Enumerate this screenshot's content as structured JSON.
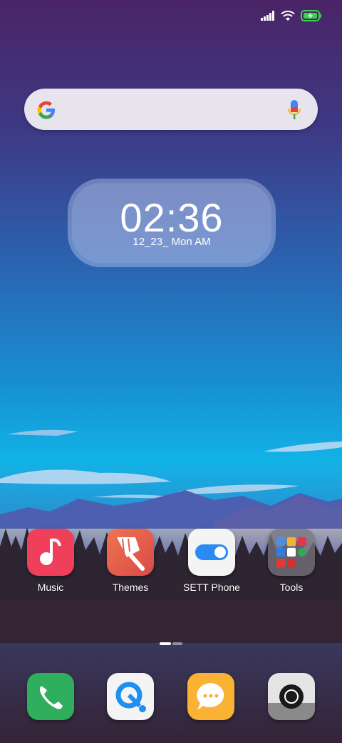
{
  "status_bar": {
    "icons": [
      "signal-icon",
      "wifi-icon",
      "battery-charging-icon"
    ]
  },
  "search_bar": {
    "logo": "google-logo",
    "mic": "mic-icon"
  },
  "clock_widget": {
    "time": "02:36",
    "date": "12_23_ Mon AM"
  },
  "apps": [
    {
      "label": "Music",
      "icon": "music-icon",
      "color": "#ef3f5a"
    },
    {
      "label": "Themes",
      "icon": "paintbrush-icon",
      "color": "#e0534b"
    },
    {
      "label": "SETT Phone",
      "icon": "toggle-icon",
      "color": "#f4f4f4"
    },
    {
      "label": "Tools",
      "icon": "folder-icon",
      "color": "#6c6c70"
    }
  ],
  "dock": [
    {
      "icon": "phone-icon",
      "color": "#2fae5e"
    },
    {
      "icon": "browser-icon",
      "color": "#f4f4f4"
    },
    {
      "icon": "messages-icon",
      "color": "#f9b233"
    },
    {
      "icon": "camera-icon",
      "color": "#dcdcdc"
    }
  ],
  "pager": {
    "current": 1,
    "total": 2
  }
}
